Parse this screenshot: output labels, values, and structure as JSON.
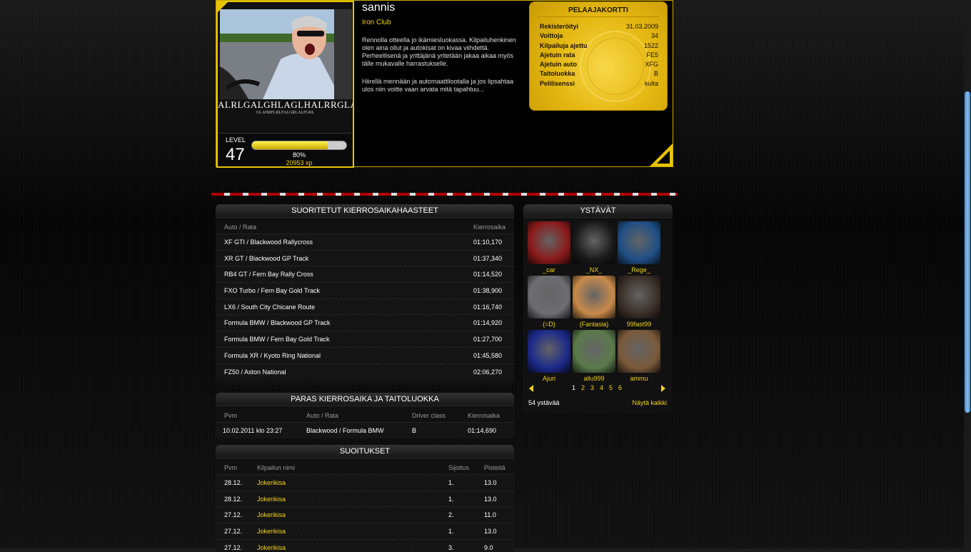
{
  "profile": {
    "username": "sannis",
    "club": "Iron Club",
    "bio_1": "Rennolla otteella jo ikämiesluokassa. Kilpailuhenkinen olen aina ollut ja autokisat on kivaa viihdettä. Perheellisenä ja yrittäjänä yritetään jakaa aikaa myös tälle mukavalle harrastukselle.",
    "bio_2": "Hiirellä mennään ja automaattilootalla ja jos lipsahtaa ulos niin voitte vaan arvata mitä tapahtuu...",
    "avatar_caption_big": "ALRLGALGHLAGLHALRRGLA",
    "avatar_caption_small": "GLAHRFLRLFALGRLALFGRL",
    "level_label": "LEVEL",
    "level": "47",
    "xp_percent_text": "80%",
    "xp_fraction": 0.8,
    "xp_total": "20953 xp"
  },
  "player_card": {
    "title": "PELAAJAKORTTI",
    "rows": [
      {
        "label": "Rekisteröityi",
        "value": "31.03.2009"
      },
      {
        "label": "Voittoja",
        "value": "34"
      },
      {
        "label": "Kilpailuja ajettu",
        "value": "1522"
      },
      {
        "label": "Ajetuin rata",
        "value": "FE5"
      },
      {
        "label": "Ajetuin auto",
        "value": "XFG"
      },
      {
        "label": "Taitoluokka",
        "value": "B"
      },
      {
        "label": "Pelilisenssi",
        "value": "kulta"
      }
    ]
  },
  "laps": {
    "title": "SUORITETUT KIERROSAIKAHAASTEET",
    "col_car": "Auto / Rata",
    "col_time": "Kierrosaika",
    "rows": [
      {
        "car": "XF GTI / Blackwood Rallycross",
        "time": "01:10,170"
      },
      {
        "car": "XR GT / Blackwood GP Track",
        "time": "01:37,340"
      },
      {
        "car": "RB4 GT / Fern Bay Rally Cross",
        "time": "01:14,520"
      },
      {
        "car": "FXO Turbo / Fern Bay Gold Track",
        "time": "01:38,900"
      },
      {
        "car": "LX6 / South City Chicane Route",
        "time": "01:16,740"
      },
      {
        "car": "Formula BMW / Blackwood GP Track",
        "time": "01:14,920"
      },
      {
        "car": "Formula BMW / Fern Bay Gold Track",
        "time": "01:27,700"
      },
      {
        "car": "Formula XR / Kyoto Ring National",
        "time": "01:45,580"
      },
      {
        "car": "FZ50 / Aston National",
        "time": "02:06,270"
      }
    ]
  },
  "best": {
    "title": "PARAS KIERROSAIKA JA TAITOLUOKKA",
    "col_date": "Pvm",
    "col_car": "Auto / Rata",
    "col_class": "Driver class",
    "col_time": "Kierrosaika",
    "row": {
      "date": "10.02.2011 klo 23:27",
      "car": "Blackwood / Formula BMW",
      "class": "B",
      "time": "01:14,690"
    }
  },
  "results": {
    "title": "SUOITUKSET",
    "col_date": "Pvm",
    "col_name": "Kilpailun nimi",
    "col_place": "Sijoitus",
    "col_points": "Pisteitä",
    "rows": [
      {
        "date": "28.12.",
        "name": "Jokerikisa",
        "place": "1.",
        "points": "13.0"
      },
      {
        "date": "28.12.",
        "name": "Jokerikisa",
        "place": "1.",
        "points": "13.0"
      },
      {
        "date": "27.12.",
        "name": "Jokerikisa",
        "place": "2.",
        "points": "11.0"
      },
      {
        "date": "27.12.",
        "name": "Jokerikisa",
        "place": "1.",
        "points": "13.0"
      },
      {
        "date": "27.12.",
        "name": "Jokerikisa",
        "place": "3.",
        "points": "9.0"
      }
    ]
  },
  "friends": {
    "title": "YSTÄVÄT",
    "items": [
      {
        "name": "_car",
        "color": "#8b1a1a"
      },
      {
        "name": "_NX_",
        "color": "#1a1a1a"
      },
      {
        "name": "_Rege_",
        "color": "#1f4f86"
      },
      {
        "name": "(=D)",
        "color": "#6d6d72"
      },
      {
        "name": "(Fantasia)",
        "color": "#c88a4a"
      },
      {
        "name": "99fast99",
        "color": "#3a2f28"
      },
      {
        "name": "Ajuri",
        "color": "#1c2a8a"
      },
      {
        "name": "allu999",
        "color": "#5b7a4b"
      },
      {
        "name": "ammu",
        "color": "#7a5a3a"
      }
    ],
    "pages": [
      "1",
      "2",
      "3",
      "4",
      "5",
      "6"
    ],
    "current_page": "1",
    "count_text": "54 ystävää",
    "show_all": "Näytä kaikki"
  },
  "colors": {
    "accent": "#f2d21a",
    "stripe_red": "#b10000"
  },
  "icons": {
    "prev": "triangle-left-icon",
    "next": "triangle-right-icon"
  }
}
